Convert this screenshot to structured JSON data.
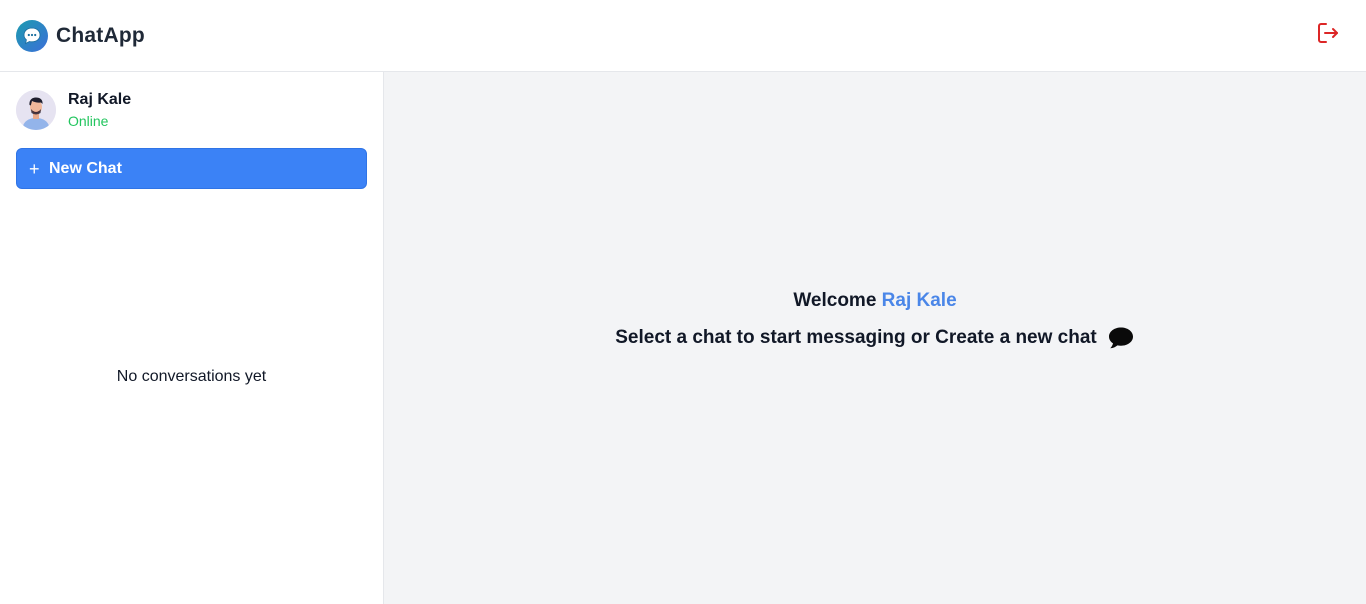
{
  "header": {
    "app_name": "ChatApp",
    "logo_icon": "chat-bubble-logo-icon",
    "logout_icon": "logout-icon"
  },
  "sidebar": {
    "user": {
      "name": "Raj Kale",
      "status": "Online",
      "avatar_icon": "user-avatar"
    },
    "new_chat": {
      "icon": "+",
      "label": "New Chat"
    },
    "empty_message": "No conversations yet"
  },
  "main": {
    "welcome_prefix": "Welcome",
    "welcome_user": "Raj Kale",
    "prompt": "Select a chat to start messaging or Create a new chat",
    "prompt_icon": "chat-bubble-icon"
  },
  "colors": {
    "accent": "#3b82f6",
    "online": "#22c55e",
    "logout": "#dc2626",
    "main_bg": "#f3f4f6"
  }
}
